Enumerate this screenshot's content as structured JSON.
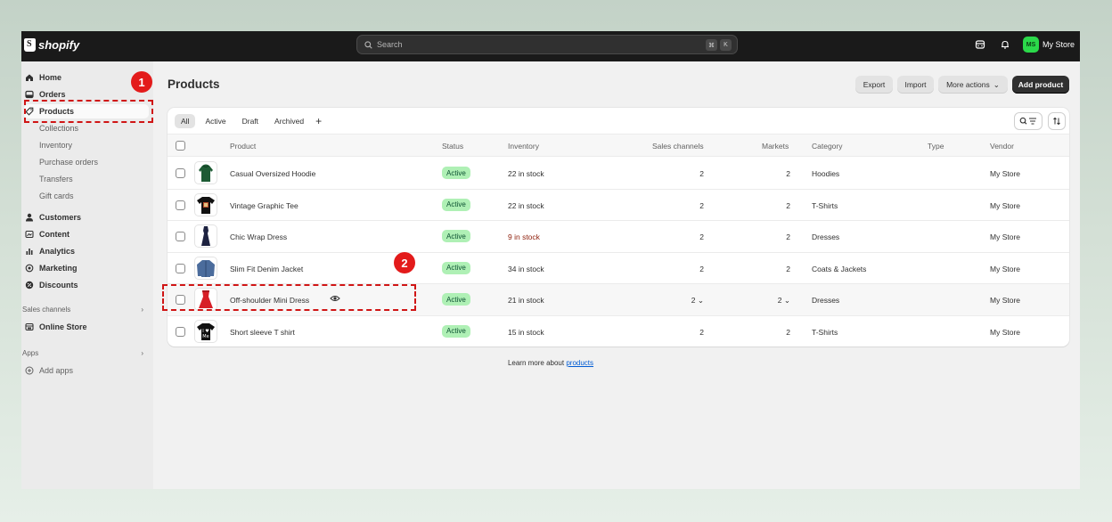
{
  "topbar": {
    "logo_text": "shopify",
    "search_placeholder": "Search",
    "shortcut_keys": [
      "⌘",
      "K"
    ],
    "avatar_initials": "MS",
    "avatar_color": "#2bd94a",
    "store_name": "My Store",
    "icons": [
      "store-icon",
      "bell-icon"
    ]
  },
  "sidebar": {
    "main_items": [
      {
        "label": "Home",
        "icon": "home-icon"
      },
      {
        "label": "Orders",
        "icon": "orders-icon"
      },
      {
        "label": "Products",
        "icon": "tag-icon",
        "active": true
      }
    ],
    "product_subitems": [
      "Collections",
      "Inventory",
      "Purchase orders",
      "Transfers",
      "Gift cards"
    ],
    "more_items": [
      {
        "label": "Customers",
        "icon": "person-icon"
      },
      {
        "label": "Content",
        "icon": "content-icon"
      },
      {
        "label": "Analytics",
        "icon": "analytics-icon"
      },
      {
        "label": "Marketing",
        "icon": "target-icon"
      },
      {
        "label": "Discounts",
        "icon": "discount-icon"
      }
    ],
    "sales_channels_label": "Sales channels",
    "online_store_label": "Online Store",
    "apps_label": "Apps",
    "add_apps_label": "Add apps"
  },
  "header": {
    "title": "Products",
    "export_label": "Export",
    "import_label": "Import",
    "more_actions_label": "More actions",
    "add_product_label": "Add product"
  },
  "tabs": [
    "All",
    "Active",
    "Draft",
    "Archived"
  ],
  "table": {
    "columns": [
      "Product",
      "Status",
      "Inventory",
      "Sales channels",
      "Markets",
      "Category",
      "Type",
      "Vendor"
    ],
    "rows": [
      {
        "product": "Casual Oversized Hoodie",
        "status": "Active",
        "inventory": "22 in stock",
        "low_stock": false,
        "sales_channels": "2",
        "markets": "2",
        "category": "Hoodies",
        "type": "",
        "vendor": "My Store",
        "thumb": "hoodie"
      },
      {
        "product": "Vintage Graphic Tee",
        "status": "Active",
        "inventory": "22 in stock",
        "low_stock": false,
        "sales_channels": "2",
        "markets": "2",
        "category": "T-Shirts",
        "type": "",
        "vendor": "My Store",
        "thumb": "tee"
      },
      {
        "product": "Chic Wrap Dress",
        "status": "Active",
        "inventory": "9 in stock",
        "low_stock": true,
        "sales_channels": "2",
        "markets": "2",
        "category": "Dresses",
        "type": "",
        "vendor": "My Store",
        "thumb": "dress-dark"
      },
      {
        "product": "Slim Fit Denim Jacket",
        "status": "Active",
        "inventory": "34 in stock",
        "low_stock": false,
        "sales_channels": "2",
        "markets": "2",
        "category": "Coats & Jackets",
        "type": "",
        "vendor": "My Store",
        "thumb": "jacket"
      },
      {
        "product": "Off-shoulder Mini Dress",
        "status": "Active",
        "inventory": "21 in stock",
        "low_stock": false,
        "sales_channels": "2",
        "markets": "2",
        "category": "Dresses",
        "type": "",
        "vendor": "My Store",
        "thumb": "dress-red",
        "hovered": true
      },
      {
        "product": "Short sleeve T shirt",
        "status": "Active",
        "inventory": "15 in stock",
        "low_stock": false,
        "sales_channels": "2",
        "markets": "2",
        "category": "T-Shirts",
        "type": "",
        "vendor": "My Store",
        "thumb": "tee-love"
      }
    ]
  },
  "footer": {
    "learn_more_text": "Learn more about",
    "learn_more_link": "products"
  },
  "annotations": {
    "step1": "1",
    "step2": "2",
    "color": "#d01515"
  },
  "colors": {
    "topbar_bg": "#1a1a1a",
    "active_badge_bg": "#aff0b5",
    "low_stock_text": "#8e1f0b",
    "primary_button": "#303030"
  }
}
